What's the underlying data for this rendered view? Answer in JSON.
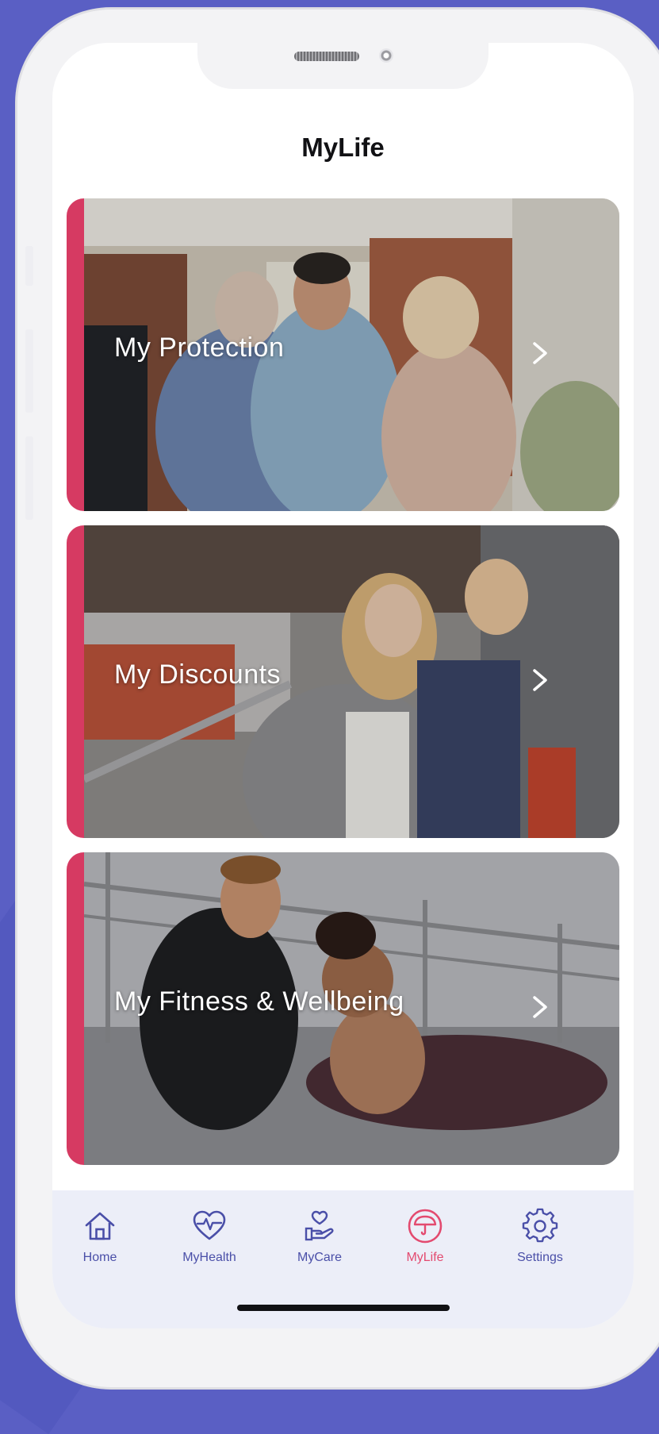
{
  "app": {
    "title": "MyLife"
  },
  "cards": [
    {
      "label": "My Protection"
    },
    {
      "label": "My Discounts"
    },
    {
      "label": "My Fitness & Wellbeing"
    }
  ],
  "tabs": [
    {
      "label": "Home",
      "icon": "home-icon"
    },
    {
      "label": "MyHealth",
      "icon": "heart-pulse-icon"
    },
    {
      "label": "MyCare",
      "icon": "hand-heart-icon"
    },
    {
      "label": "MyLife",
      "icon": "umbrella-icon",
      "active": true
    },
    {
      "label": "Settings",
      "icon": "gear-icon"
    }
  ],
  "colors": {
    "background": "#5a5fc4",
    "accent": "#d63a62",
    "tab_inactive": "#4a4fa8",
    "tab_active": "#e34a6f",
    "tabbar": "#eceef8"
  }
}
